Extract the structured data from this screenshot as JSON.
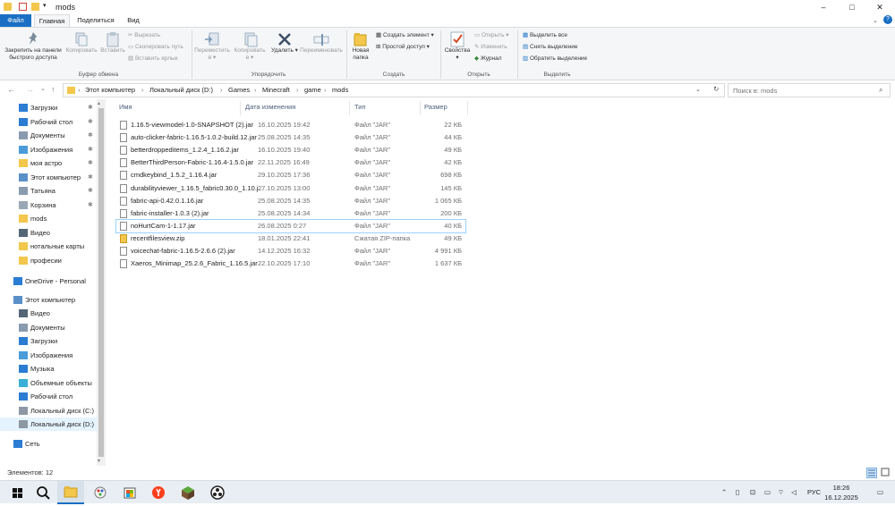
{
  "window": {
    "title": "mods",
    "minimize": "–",
    "maximize": "□",
    "close": "✕"
  },
  "ribbon_tabs": [
    "Файл",
    "Главная",
    "Поделиться",
    "Вид"
  ],
  "ribbon": {
    "clipboard": {
      "pin_label": "Закрепить на панели быстрого доступа",
      "copy": "Копировать",
      "paste": "Вставить",
      "cut": "Вырезать",
      "copy_path": "Скопировать путь",
      "paste_shortcut": "Вставить ярлык",
      "group": "Буфер обмена"
    },
    "organize": {
      "move": "Переместить в",
      "copy_to": "Копировать в",
      "delete": "Удалить",
      "rename": "Переименовать",
      "group": "Упорядочить"
    },
    "create": {
      "new_folder": "Новая папка",
      "new_item": "Создать элемент",
      "easy_access": "Простой доступ",
      "group": "Создать"
    },
    "open": {
      "properties": "Свойства",
      "open": "Открыть",
      "edit": "Изменить",
      "history": "Журнал",
      "group": "Открыть"
    },
    "select": {
      "select_all": "Выделить все",
      "select_none": "Снять выделение",
      "invert": "Обратить выделение",
      "group": "Выделить"
    }
  },
  "address": {
    "crumbs": [
      "Этот компьютер",
      "Локальный диск (D:)",
      "Games",
      "Minecraft",
      "game",
      "mods"
    ],
    "search_placeholder": "Поиск в: mods"
  },
  "nav": {
    "quick_access": [
      {
        "label": "Загрузки",
        "icon": "download-icon",
        "pinned": true
      },
      {
        "label": "Рабочий стол",
        "icon": "desktop-icon",
        "pinned": true
      },
      {
        "label": "Документы",
        "icon": "documents-icon",
        "pinned": true
      },
      {
        "label": "Изображения",
        "icon": "pictures-icon",
        "pinned": true
      },
      {
        "label": "моя астро",
        "icon": "folder-icon",
        "pinned": true
      },
      {
        "label": "Этот компьютер",
        "icon": "computer-icon",
        "pinned": true
      },
      {
        "label": "Татьяна",
        "icon": "user-folder-icon",
        "pinned": true
      },
      {
        "label": "Корзина",
        "icon": "recycle-bin-icon",
        "pinned": true
      },
      {
        "label": "mods",
        "icon": "folder-icon",
        "pinned": false
      },
      {
        "label": "Видео",
        "icon": "video-icon",
        "pinned": false
      },
      {
        "label": "нотальные карты",
        "icon": "folder-icon",
        "pinned": false
      },
      {
        "label": "професии",
        "icon": "folder-icon",
        "pinned": false
      }
    ],
    "onedrive": "OneDrive - Personal",
    "this_pc": "Этот компьютер",
    "pc_items": [
      {
        "label": "Видео",
        "icon": "video-icon"
      },
      {
        "label": "Документы",
        "icon": "documents-icon"
      },
      {
        "label": "Загрузки",
        "icon": "download-icon"
      },
      {
        "label": "Изображения",
        "icon": "pictures-icon"
      },
      {
        "label": "Музыка",
        "icon": "music-icon"
      },
      {
        "label": "Объемные объекты",
        "icon": "3d-objects-icon"
      },
      {
        "label": "Рабочий стол",
        "icon": "desktop-icon"
      },
      {
        "label": "Локальный диск (C:)",
        "icon": "drive-icon"
      },
      {
        "label": "Локальный диск (D:)",
        "icon": "drive-icon"
      }
    ],
    "network": "Сеть"
  },
  "columns": {
    "name": "Имя",
    "date": "Дата изменения",
    "type": "Тип",
    "size": "Размер"
  },
  "files": [
    {
      "name": "1.16.5-viewmodel-1.0-SNAPSHOT (2).jar",
      "date": "16.10.2025 19:42",
      "type": "Файл \"JAR\"",
      "size": "22 КБ"
    },
    {
      "name": "auto-clicker-fabric-1.16.5-1.0.2-build.12.jar",
      "date": "25.08.2025 14:35",
      "type": "Файл \"JAR\"",
      "size": "44 КБ"
    },
    {
      "name": "betterdroppeditems_1.2.4_1.16.2.jar",
      "date": "16.10.2025 19:40",
      "type": "Файл \"JAR\"",
      "size": "49 КБ"
    },
    {
      "name": "BetterThirdPerson-Fabric-1.16.4-1.5.0.jar",
      "date": "22.11.2025 16:49",
      "type": "Файл \"JAR\"",
      "size": "42 КБ"
    },
    {
      "name": "cmdkeybind_1.5.2_1.16.4.jar",
      "date": "29.10.2025 17:36",
      "type": "Файл \"JAR\"",
      "size": "698 КБ"
    },
    {
      "name": "durabilityviewer_1.16.5_fabric0.30.0_1.10.j...",
      "date": "27.10.2025 13:00",
      "type": "Файл \"JAR\"",
      "size": "145 КБ"
    },
    {
      "name": "fabric-api-0.42.0.1.16.jar",
      "date": "25.08.2025 14:35",
      "type": "Файл \"JAR\"",
      "size": "1 065 КБ"
    },
    {
      "name": "fabric-installer-1.0.3 (2).jar",
      "date": "25.08.2025 14:34",
      "type": "Файл \"JAR\"",
      "size": "200 КБ"
    },
    {
      "name": "noHurtCam-1-1.17.jar",
      "date": "26.08.2025 0:27",
      "type": "Файл \"JAR\"",
      "size": "40 КБ"
    },
    {
      "name": "recentfilesview.zip",
      "date": "18.01.2025 22:41",
      "type": "Сжатая ZIP-папка",
      "size": "49 КБ"
    },
    {
      "name": "voicechat-fabric-1.16.5-2.6.6 (2).jar",
      "date": "14.12.2025 16:32",
      "type": "Файл \"JAR\"",
      "size": "4 991 КБ"
    },
    {
      "name": "Xaeros_Minimap_25.2.6_Fabric_1.16.5.jar",
      "date": "22.10.2025 17:10",
      "type": "Файл \"JAR\"",
      "size": "1 637 КБ"
    }
  ],
  "status": "Элементов: 12",
  "taskbar": {
    "lang": "РУС",
    "time": "18:26",
    "date": "16.12.2025"
  }
}
